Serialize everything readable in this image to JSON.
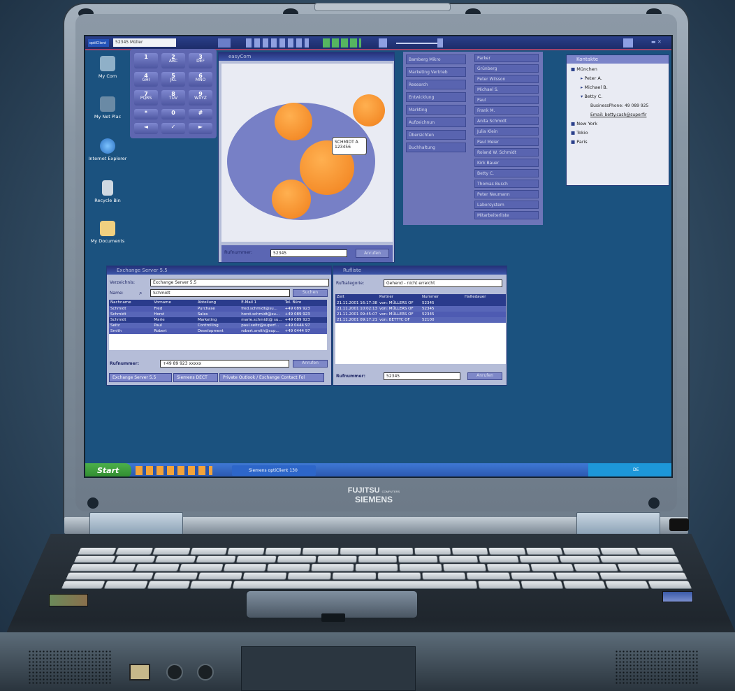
{
  "toolbar": {
    "brand": "optiClient",
    "phone_value": "52345 Müller"
  },
  "desktop_icons": [
    "My Com",
    "My Net Plac",
    "Internet Explorer",
    "Recycle Bin",
    "My Documents"
  ],
  "keypad": {
    "keys": [
      {
        "digit": "1",
        "letters": ""
      },
      {
        "digit": "2",
        "letters": "ABC"
      },
      {
        "digit": "3",
        "letters": "DEF"
      },
      {
        "digit": "4",
        "letters": "GHI"
      },
      {
        "digit": "5",
        "letters": "JKL"
      },
      {
        "digit": "6",
        "letters": "MNO"
      },
      {
        "digit": "7",
        "letters": "PQRS"
      },
      {
        "digit": "8",
        "letters": "TUV"
      },
      {
        "digit": "9",
        "letters": "WXYZ"
      },
      {
        "digit": "*",
        "letters": ""
      },
      {
        "digit": "0",
        "letters": ""
      },
      {
        "digit": "#",
        "letters": ""
      },
      {
        "digit": "◄",
        "letters": ""
      },
      {
        "digit": "✓",
        "letters": ""
      },
      {
        "digit": "►",
        "letters": ""
      }
    ]
  },
  "easycom": {
    "title": "easyCom",
    "bubble": "SCHMIDT A 123456",
    "rufnummer_label": "Rufnummer:",
    "rufnummer_value": "52345",
    "call_button": "Anrufen"
  },
  "buddy_list": {
    "col1": [
      "Bamberg Mikro",
      "Marketing Vertrieb",
      "Research",
      "Entwicklung",
      "Markting",
      "Aufzeichnun",
      "Übersichten",
      "Buchhaltung"
    ],
    "col2": [
      "Parker",
      "Grünberg",
      "Peter Wilsson",
      "Michael S.",
      "Paul",
      "Frank M.",
      "Anita Schmidt",
      "Julia Klein",
      "Paul Meier",
      "Roland W. Schmidt",
      "Kirk Bauer",
      "Betty C.",
      "Thomas Busch",
      "Peter Neumann",
      "Laborsystem",
      "Mitarbeiterliste"
    ]
  },
  "kontakte": {
    "title": "Kontakte",
    "tree": [
      {
        "label": "München",
        "depth": 0
      },
      {
        "label": "Peter A.",
        "depth": 1
      },
      {
        "label": "Michael B.",
        "depth": 1
      },
      {
        "label": "Betty C.",
        "depth": 1
      },
      {
        "label": "BusinessPhone: 49 089 925",
        "depth": 2
      },
      {
        "label": "Email: betty.cash@superfir",
        "depth": 2
      },
      {
        "label": "New York",
        "depth": 0
      },
      {
        "label": "Tokio",
        "depth": 0
      },
      {
        "label": "Paris",
        "depth": 0
      }
    ]
  },
  "exchange": {
    "title": "Exchange Server 5.5",
    "verzeichnis_label": "Verzeichnis:",
    "verzeichnis_value": "Exchange Server 5.5",
    "name_label": "Name:",
    "name_value": "Schmidt",
    "search_button": "Suchen",
    "columns": [
      "Nachname",
      "Vorname",
      "Abteilung",
      "E-Mail 1",
      "Tel. Büro"
    ],
    "rows": [
      [
        "Schmidt",
        "Fred",
        "Purchase",
        "fred.schmidt@su...",
        "+49 089 923"
      ],
      [
        "Schmidt",
        "Horst",
        "Sales",
        "horst.schmidt@su...",
        "+49 089 923"
      ],
      [
        "Schmidt",
        "Marie",
        "Marketing",
        "marie.schmidt@ su...",
        "+49 089 923"
      ],
      [
        "Seitz",
        "Paul",
        "Controlling",
        "paul.seitz@superf...",
        "+49 0444 97"
      ],
      [
        "Smith",
        "Robert",
        "Development",
        "robert.smith@sup...",
        "+49 0444 97"
      ]
    ],
    "rufnummer_label": "Rufnummer:",
    "rufnummer_value": "+49 89 923 xxxxx",
    "call_button": "Anrufen",
    "tabs": [
      "Exchange Server 5.5",
      "Siemens DECT",
      "Private Outlook / Exchange Contact Fol"
    ]
  },
  "rufliste": {
    "title": "Rufliste",
    "kategorie_label": "Rufkategorie:",
    "kategorie_value": "Gehend - nicht erreicht",
    "columns": [
      "Zeit",
      "Partner",
      "Nummer",
      "Haltedauer"
    ],
    "rows": [
      [
        "21.11.2001 16:17:38",
        "von: MÜLLERS OF",
        "52345",
        ""
      ],
      [
        "21.11.2001 10:02:13",
        "von: MÜLLERS OF",
        "52345",
        ""
      ],
      [
        "21.11.2001 09:45:07",
        "von: MÜLLERS OF",
        "52345",
        ""
      ],
      [
        "21.11.2001 09:17:21",
        "von: BETTYC OF",
        "52100",
        ""
      ]
    ],
    "rufnummer_label": "Rufnummer:",
    "rufnummer_value": "52345",
    "call_button": "Anrufen"
  },
  "taskbar": {
    "start": "Start",
    "task": "Siemens optiClient 130",
    "tray": "DE"
  },
  "laptop": {
    "brand_top": "FUJITSU",
    "brand_small": "COMPUTERS",
    "brand_bottom": "SIEMENS"
  }
}
